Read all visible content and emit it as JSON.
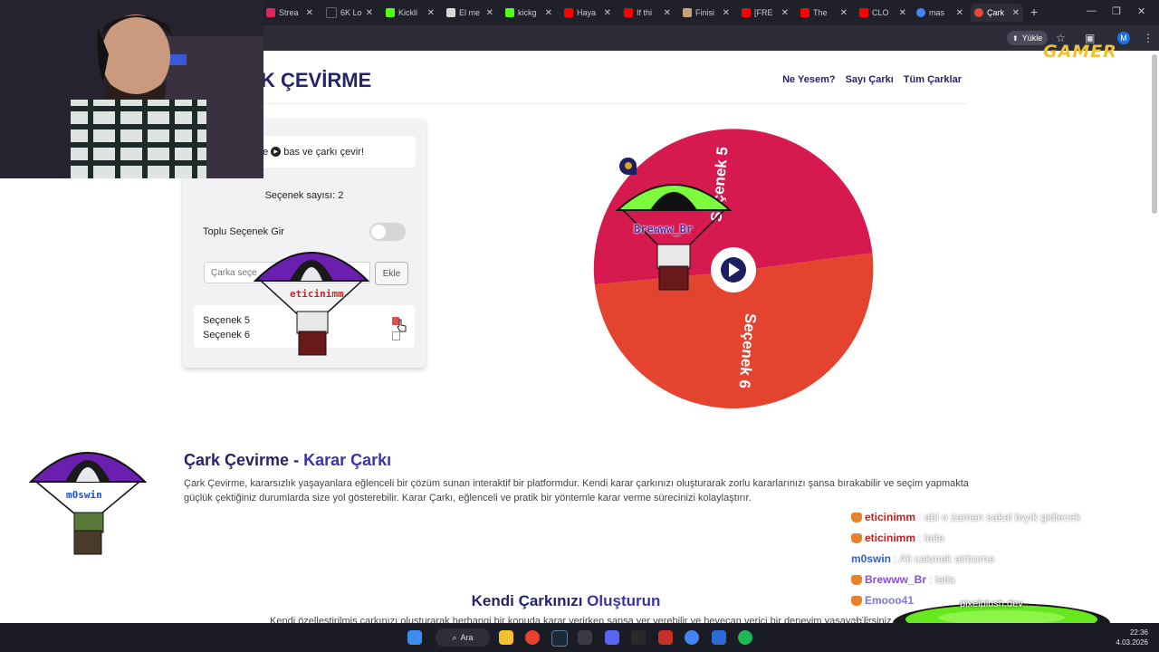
{
  "browser": {
    "tabs": [
      {
        "title": "Strea",
        "color": "#e0245e"
      },
      {
        "title": "6K Lo",
        "color": "#1f1f2e"
      },
      {
        "title": "Kickli",
        "color": "#53fc18"
      },
      {
        "title": "El me",
        "color": "#d8d8d8"
      },
      {
        "title": "kickg",
        "color": "#53fc18"
      },
      {
        "title": "Haya",
        "color": "#ff0000"
      },
      {
        "title": "If thi",
        "color": "#ff0000"
      },
      {
        "title": "Finisi",
        "color": "#c7a27a"
      },
      {
        "title": "[FRE",
        "color": "#ff0000"
      },
      {
        "title": "The",
        "color": "#ff0000"
      },
      {
        "title": "CLO",
        "color": "#ff0000"
      },
      {
        "title": "mas",
        "color": "#4285f4"
      },
      {
        "title": "Çark",
        "color": "#e6493a"
      }
    ],
    "new_tab": "+",
    "upload_button": "Yükle",
    "profile_initial": "M"
  },
  "overlay_logo": "GAMER",
  "site": {
    "title": "K ÇEVİRME",
    "nav": [
      "Ne Yesem?",
      "Sayı Çarkı",
      "Tüm Çarklar"
    ]
  },
  "panel": {
    "instruction_prefix": "ire",
    "instruction_suffix": "bas ve çarkı çevir!",
    "option_count": "Seçenek sayısı: 2",
    "bulk_label": "Toplu Seçenek Gir",
    "bulk_enabled": false,
    "input_placeholder": "Çarka seçe",
    "input_placeholder_tail": "n",
    "add_button": "Ekle",
    "options": [
      "Seçenek 5",
      "Seçenek 6"
    ]
  },
  "wheel": {
    "segments": [
      {
        "label": "Seçenek 5",
        "color": "#d61a4f"
      },
      {
        "label": "Seçenek 6",
        "color": "#e4432f"
      }
    ],
    "center_color": "#1e1f5e"
  },
  "parachuters": [
    {
      "name": "Brewww_Br",
      "canopy": "#7cfc3c",
      "name_color": "#5a2a9a"
    },
    {
      "name": "eticinimm",
      "canopy": "#6a1fb0",
      "name_color": "#cc1f1f"
    },
    {
      "name": "m0swin",
      "canopy": "#6a1fb0",
      "name_color": "#1e4fd8"
    }
  ],
  "sections": {
    "about_title_main": "Çark Çevirme - ",
    "about_title_accent": "Karar Çarkı",
    "about_text": "Çark Çevirme, kararsızlık yaşayanlara eğlenceli bir çözüm sunan interaktif bir platformdur. Kendi karar çarkınızı oluşturarak zorlu kararlarınızı şansa bırakabilir ve seçim yapmakta güçlük çektiğiniz durumlarda size yol gösterebilir. Karar Çarkı, eğlenceli ve pratik bir yöntemle karar verme sürecinizi kolaylaştırır.",
    "create_title_main": "Kendi Çarkınızı ",
    "create_title_accent": "Oluşturun",
    "create_text": "Kendi özelleştirilmiş çarkınızı oluşturarak herhangi bir konuda karar verirken şansa yer verebilir ve heyecan verici bir deneyim yaşayabilirsiniz."
  },
  "chat": [
    {
      "user": "eticinimm",
      "user_color": "#c21f1f",
      "message": ": abi o zaman sakal bıyık gidiecek"
    },
    {
      "user": "eticinimm",
      "user_color": "#c21f1f",
      "message": ": latla"
    },
    {
      "user": "m0swin",
      "user_color": "#2a5fd6",
      "message": ": Ali cakmak airborne"
    },
    {
      "user": "Brewww_Br",
      "user_color": "#8a4fd8",
      "message": ": latla"
    },
    {
      "user": "Emooo41",
      "user_color": "#7a7ad8",
      "message": ""
    }
  ],
  "cauldron_label": "pixelplush.dev",
  "cauldron_tail": "nda",
  "taskbar": {
    "search_label": "Ara",
    "time": "22:36",
    "date": "4.03.2026"
  }
}
